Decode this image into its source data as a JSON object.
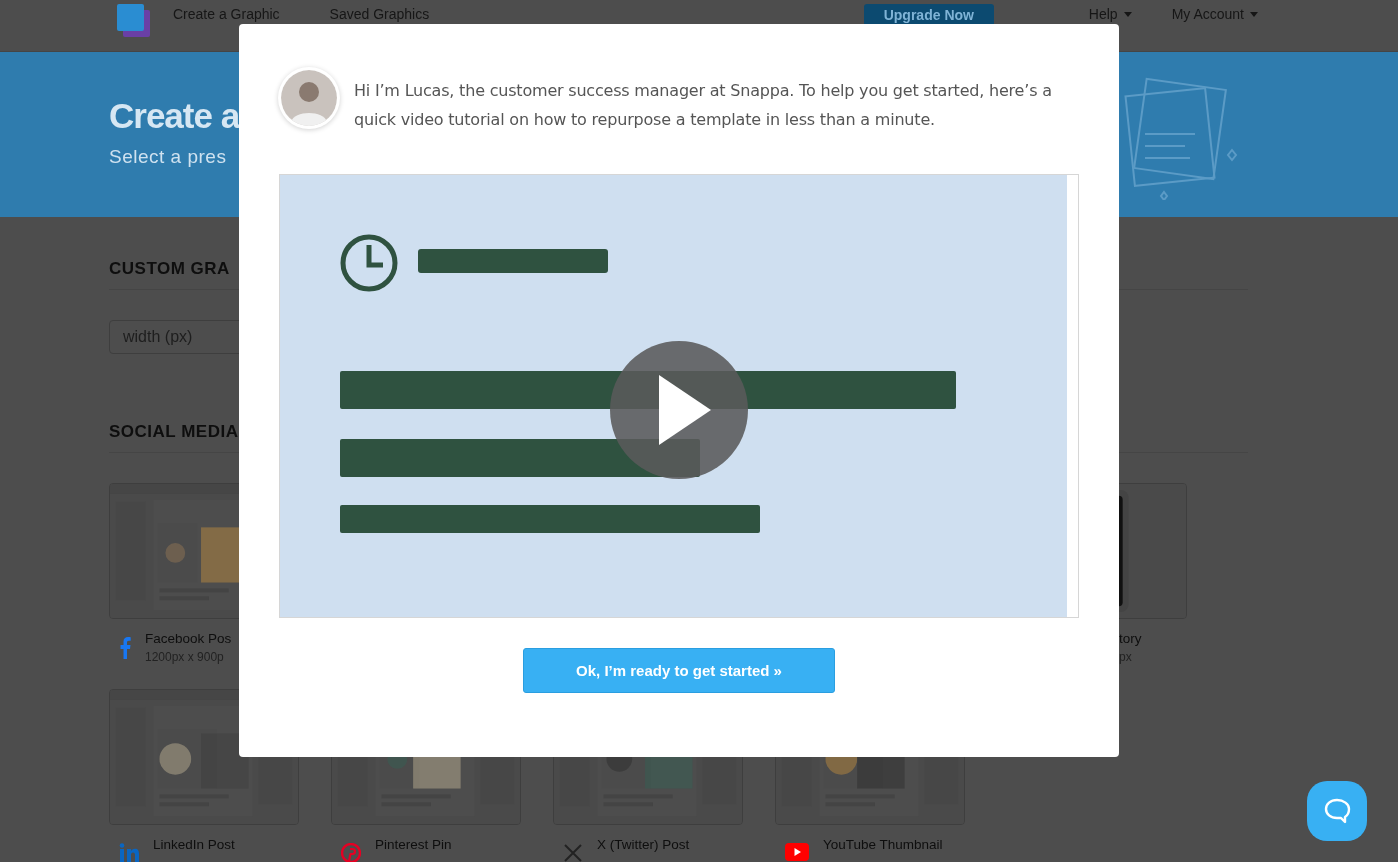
{
  "header": {
    "nav": [
      {
        "label": "Create a Graphic"
      },
      {
        "label": "Saved Graphics"
      }
    ],
    "upgrade_button": "Upgrade Now",
    "menus": [
      {
        "label": "Help"
      },
      {
        "label": "My Account"
      }
    ]
  },
  "banner": {
    "title": "Create a",
    "subtitle": "Select a pres"
  },
  "custom_section": {
    "heading": "CUSTOM GRA",
    "width_field": {
      "placeholder": "width (px)"
    }
  },
  "social_section": {
    "heading": "SOCIAL MEDIA",
    "rows": [
      [
        {
          "kind": "facebook",
          "title": "Facebook Pos",
          "size": "1200px x 900p"
        },
        {
          "kind": "cut",
          "title": "tory",
          "size": "px"
        }
      ],
      [
        {
          "kind": "linkedin",
          "title": "LinkedIn Post"
        },
        {
          "kind": "pinterest",
          "title": "Pinterest Pin"
        },
        {
          "kind": "x",
          "title": "X (Twitter) Post"
        },
        {
          "kind": "youtube",
          "title": "YouTube Thumbnail"
        }
      ]
    ]
  },
  "modal": {
    "message": "Hi I’m Lucas, the customer success manager at Snappa. To help you get started, here’s a quick video tutorial on how to repurpose a template in less than a minute.",
    "confirm_button": "Ok, I’m ready to get started »"
  }
}
